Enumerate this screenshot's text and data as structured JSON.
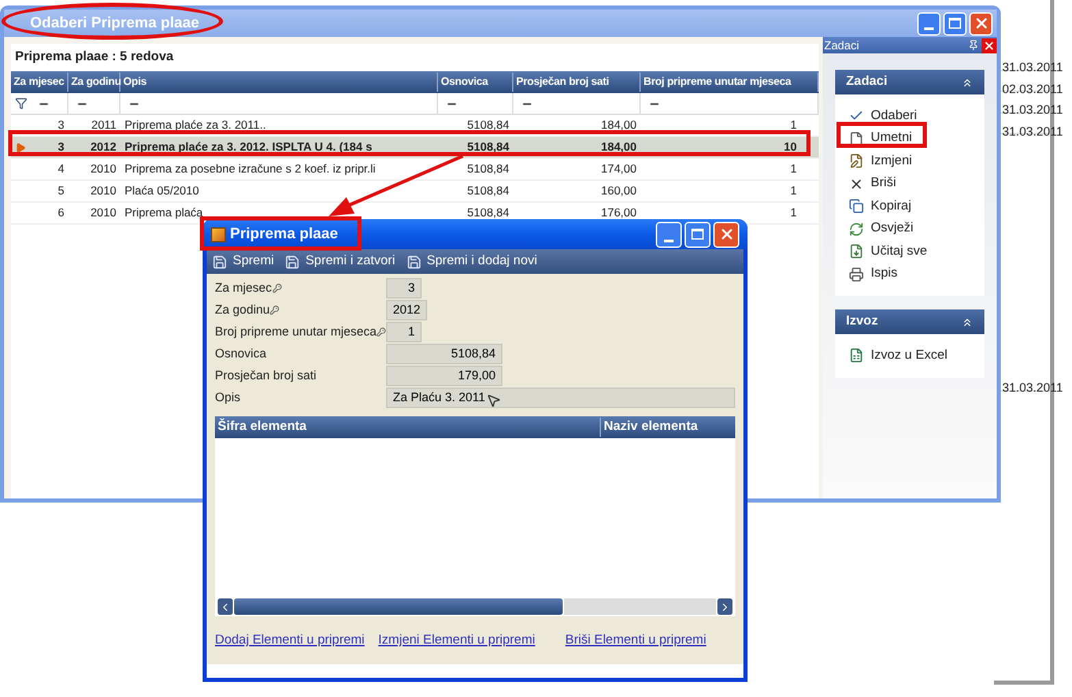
{
  "background_list": {
    "top_dates": [
      "31.03.2011",
      "02.03.2011",
      "31.03.2011",
      "31.03.2011"
    ],
    "lower_dates": [
      "31.03.2011"
    ]
  },
  "main_window": {
    "title": "Odaberi Priprema plaae",
    "grid": {
      "caption": "Priprema plaae : 5 redova",
      "columns": [
        "Za mjesec",
        "Za godinu",
        "Opis",
        "Osnovica",
        "Prosječan broj sati",
        "Broj pripreme unutar mjeseca"
      ],
      "rows": [
        {
          "cells": [
            "3",
            "2011",
            "Priprema plaće za 3. 2011..",
            "5108,84",
            "184,00",
            "1"
          ],
          "selected": false
        },
        {
          "cells": [
            "3",
            "2012",
            "Priprema plaće za 3. 2012. ISPLTA U 4. (184 s",
            "5108,84",
            "184,00",
            "10"
          ],
          "selected": true
        },
        {
          "cells": [
            "4",
            "2010",
            "Priprema za posebne izračune s 2 koef. iz pripr.li",
            "5108,84",
            "174,00",
            "1"
          ],
          "selected": false
        },
        {
          "cells": [
            "5",
            "2010",
            "Plaća 05/2010",
            "5108,84",
            "160,00",
            "1"
          ],
          "selected": false
        },
        {
          "cells": [
            "6",
            "2010",
            "Priprema plaća",
            "5108,84",
            "176,00",
            "1"
          ],
          "selected": false
        }
      ]
    }
  },
  "task_pane": {
    "title": "Zadaci",
    "groups": [
      {
        "title": "Zadaci",
        "items": [
          "Odaberi",
          "Umetni",
          "Izmjeni",
          "Briši",
          "Kopiraj",
          "Osvježi",
          "Učitaj sve",
          "Ispis"
        ]
      },
      {
        "title": "Izvoz",
        "items": [
          "Izvoz u Excel"
        ]
      }
    ]
  },
  "dialog": {
    "title": "Priprema plaae",
    "toolbar": [
      "Spremi",
      "Spremi i zatvori",
      "Spremi i dodaj novi"
    ],
    "fields": [
      {
        "label": "Za mjesec",
        "value": "3",
        "required": true,
        "kind": "int"
      },
      {
        "label": "Za godinu",
        "value": "2012",
        "required": true,
        "kind": "int"
      },
      {
        "label": "Broj pripreme unutar mjeseca",
        "value": "1",
        "required": true,
        "kind": "int"
      },
      {
        "label": "Osnovica",
        "value": "5108,84",
        "required": false,
        "kind": "decimal"
      },
      {
        "label": "Prosječan broj sati",
        "value": "179,00",
        "required": false,
        "kind": "decimal"
      },
      {
        "label": "Opis",
        "value": "Za Plaću 3. 2011",
        "required": false,
        "kind": "text"
      }
    ],
    "grid_columns": [
      "Šifra elementa",
      "Naziv elementa"
    ],
    "links": [
      "Dodaj Elementi u pripremi",
      "Izmjeni Elementi u pripremi",
      "Briši Elementi u pripremi"
    ]
  }
}
